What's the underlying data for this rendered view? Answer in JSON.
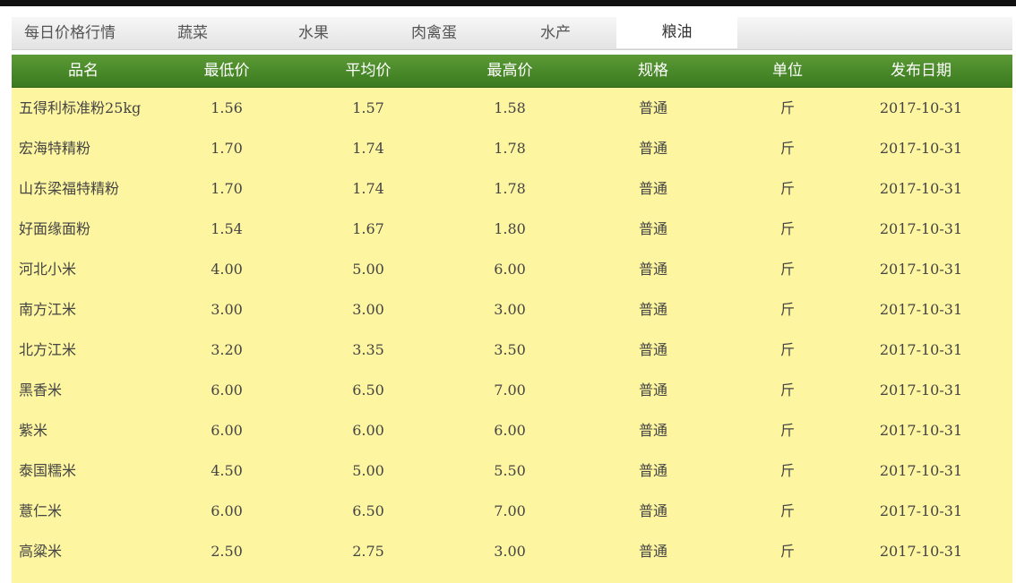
{
  "tabs": {
    "title": "每日价格行情",
    "items": [
      {
        "label": "蔬菜",
        "active": false
      },
      {
        "label": "水果",
        "active": false
      },
      {
        "label": "肉禽蛋",
        "active": false
      },
      {
        "label": "水产",
        "active": false
      },
      {
        "label": "粮油",
        "active": true
      }
    ]
  },
  "table": {
    "headers": [
      "品名",
      "最低价",
      "平均价",
      "最高价",
      "规格",
      "单位",
      "发布日期"
    ],
    "rows": [
      [
        "五得利标准粉25kg",
        "1.56",
        "1.57",
        "1.58",
        "普通",
        "斤",
        "2017-10-31"
      ],
      [
        "宏海特精粉",
        "1.70",
        "1.74",
        "1.78",
        "普通",
        "斤",
        "2017-10-31"
      ],
      [
        "山东梁福特精粉",
        "1.70",
        "1.74",
        "1.78",
        "普通",
        "斤",
        "2017-10-31"
      ],
      [
        "好面缘面粉",
        "1.54",
        "1.67",
        "1.80",
        "普通",
        "斤",
        "2017-10-31"
      ],
      [
        "河北小米",
        "4.00",
        "5.00",
        "6.00",
        "普通",
        "斤",
        "2017-10-31"
      ],
      [
        "南方江米",
        "3.00",
        "3.00",
        "3.00",
        "普通",
        "斤",
        "2017-10-31"
      ],
      [
        "北方江米",
        "3.20",
        "3.35",
        "3.50",
        "普通",
        "斤",
        "2017-10-31"
      ],
      [
        "黑香米",
        "6.00",
        "6.50",
        "7.00",
        "普通",
        "斤",
        "2017-10-31"
      ],
      [
        "紫米",
        "6.00",
        "6.00",
        "6.00",
        "普通",
        "斤",
        "2017-10-31"
      ],
      [
        "泰国糯米",
        "4.50",
        "5.00",
        "5.50",
        "普通",
        "斤",
        "2017-10-31"
      ],
      [
        "薏仁米",
        "6.00",
        "6.50",
        "7.00",
        "普通",
        "斤",
        "2017-10-31"
      ],
      [
        "高粱米",
        "2.50",
        "2.75",
        "3.00",
        "普通",
        "斤",
        "2017-10-31"
      ]
    ]
  },
  "colors": {
    "header_green": "#4a8a2a",
    "row_background": "#fdf59f"
  }
}
